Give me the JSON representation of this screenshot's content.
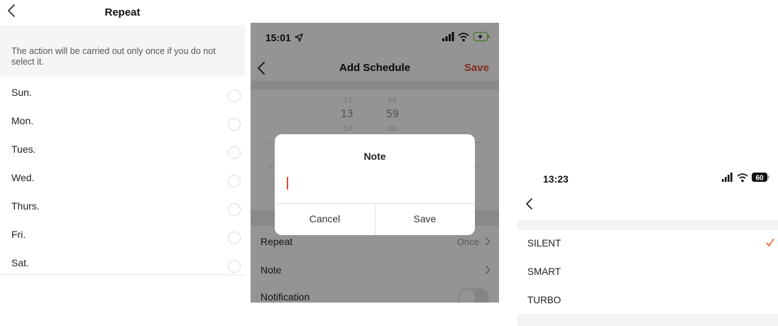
{
  "repeat_screen": {
    "title": "Repeat",
    "hint": "The action will be carried out only once if you do not select it.",
    "days": [
      {
        "label": "Sun.",
        "selected": false
      },
      {
        "label": "Mon.",
        "selected": false
      },
      {
        "label": "Tues.",
        "selected": false
      },
      {
        "label": "Wed.",
        "selected": false
      },
      {
        "label": "Thurs.",
        "selected": false
      },
      {
        "label": "Fri.",
        "selected": false
      },
      {
        "label": "Sat.",
        "selected": false
      }
    ]
  },
  "schedule_screen": {
    "status_time": "15:01",
    "title": "Add Schedule",
    "save_label": "Save",
    "picker": {
      "hours": [
        "12",
        "13",
        "14"
      ],
      "minutes": [
        "58",
        "59",
        "00"
      ]
    },
    "settings": [
      {
        "label": "Repeat",
        "value": "Once"
      },
      {
        "label": "Note",
        "value": ""
      },
      {
        "label": "Notification",
        "value": ""
      }
    ],
    "notification_enabled": false,
    "accent_color": "#e14b2b",
    "dialog": {
      "title": "Note",
      "input_value": "",
      "cancel_label": "Cancel",
      "save_label": "Save"
    }
  },
  "mode_screen": {
    "status_time": "13:23",
    "battery_level": "60",
    "modes": [
      {
        "label": "SILENT",
        "selected": true
      },
      {
        "label": "SMART",
        "selected": false
      },
      {
        "label": "TURBO",
        "selected": false
      }
    ],
    "check_color": "#f26b3a"
  }
}
